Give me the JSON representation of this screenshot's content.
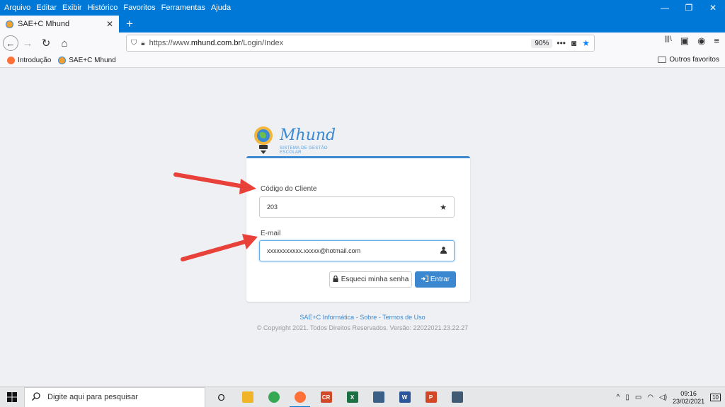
{
  "menubar": {
    "items": [
      "Arquivo",
      "Editar",
      "Exibir",
      "Histórico",
      "Favoritos",
      "Ferramentas",
      "Ajuda"
    ]
  },
  "window_controls": {
    "minimize": "—",
    "restore": "❐",
    "close": "✕"
  },
  "tab": {
    "title": "SAE+C Mhund",
    "close": "✕",
    "new": "+"
  },
  "nav": {
    "back": "←",
    "forward": "→",
    "reload": "↻",
    "home": "⌂"
  },
  "address": {
    "prefix": "https://www.",
    "domain": "mhund.com.br",
    "path": "/Login/Index",
    "zoom": "90%"
  },
  "url_icons": {
    "more": "•••",
    "pocket": "◙",
    "star": "★"
  },
  "toolbar_icons": {
    "library": "|||\\",
    "sidebar": "▣",
    "account": "◉",
    "menu": "≡"
  },
  "bookmarks": {
    "items": [
      "Introdução",
      "SAE+C Mhund"
    ],
    "other": "Outros favoritos"
  },
  "logo": {
    "brand": "Mhund",
    "tagline": "SISTEMA DE GESTÃO ESCOLAR"
  },
  "login": {
    "client_code_label": "Código do Cliente",
    "client_code_value": "203",
    "email_label": "E-mail",
    "email_value": "xxxxxxxxxxx.xxxxx@hotmail.com",
    "forgot_label": "Esqueci minha senha",
    "enter_label": "Entrar"
  },
  "footer": {
    "company": "SAE+C Informática",
    "sep1": " - ",
    "about": "Sobre",
    "sep2": " - ",
    "terms": "Termos de Uso",
    "copyright": "© Copyright 2021. Todos Direitos Reservados. Versão: 22022021.23.22.27"
  },
  "taskbar": {
    "search_placeholder": "Digite aqui para pesquisar",
    "apps": [
      {
        "name": "task-view",
        "label": "O",
        "color": "#e6e7e8"
      },
      {
        "name": "file-explorer",
        "label": "",
        "color": "#f0b429"
      },
      {
        "name": "chrome",
        "label": "",
        "color": "#34a853"
      },
      {
        "name": "firefox",
        "label": "",
        "color": "#ff7139"
      },
      {
        "name": "app-cr",
        "label": "CR",
        "color": "#d04a2a"
      },
      {
        "name": "excel",
        "label": "X",
        "color": "#1d7044"
      },
      {
        "name": "calculator",
        "label": "",
        "color": "#3b5f86"
      },
      {
        "name": "word",
        "label": "W",
        "color": "#2b579a"
      },
      {
        "name": "powerpoint",
        "label": "P",
        "color": "#d24726"
      },
      {
        "name": "camera",
        "label": "",
        "color": "#3f5a72"
      }
    ],
    "time": "09:16",
    "date": "23/02/2021",
    "notifications": "10"
  },
  "colors": {
    "accent": "#3c88d0",
    "titlebar": "#0078d7",
    "arrow": "#e8413a"
  }
}
